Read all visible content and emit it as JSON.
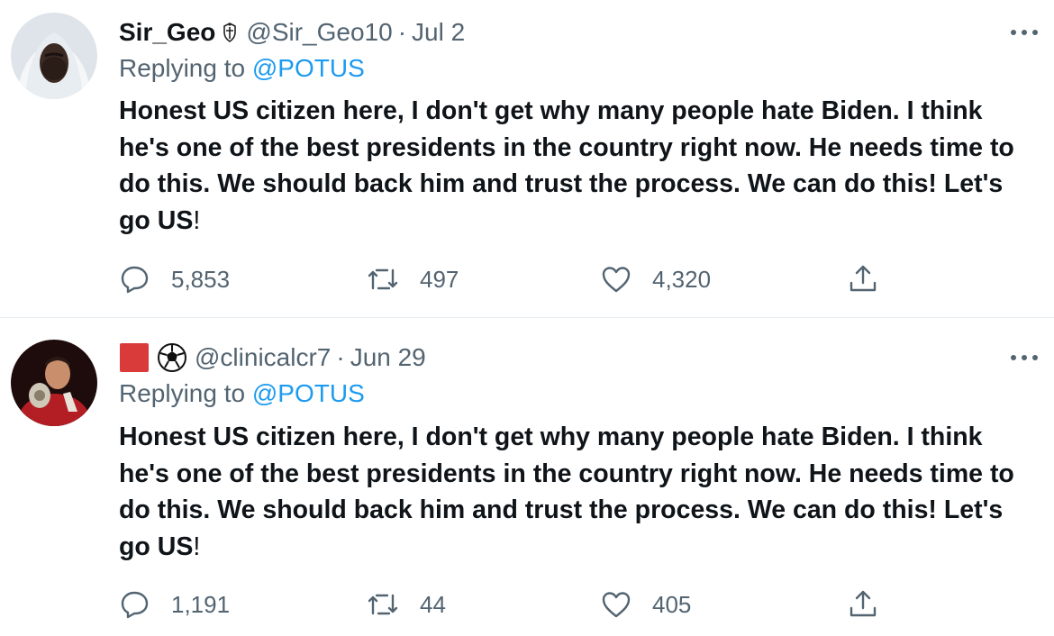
{
  "tweets": [
    {
      "display_name": "Sir_Geo",
      "handle": "@Sir_Geo10",
      "separator": "·",
      "date": "Jul 2",
      "reply_prefix": "Replying to ",
      "reply_to": "@POTUS",
      "text": "Honest US citizen here, I don't get why many people hate Biden. I think he's one of the best presidents  in the country right now. He needs time to do this. We should back him and trust the process. We can do this! Let's go US",
      "text_tail": "!",
      "replies": "5,853",
      "retweets": "497",
      "likes": "4,320"
    },
    {
      "display_name": "",
      "handle": "@clinicalcr7",
      "separator": "·",
      "date": "Jun 29",
      "reply_prefix": "Replying to ",
      "reply_to": "@POTUS",
      "text": "Honest US citizen here, I don't get why many people hate Biden. I think he's one of the best presidents  in the country right now. He needs time to do this. We should back him and trust the process. We can do this! Let's go US",
      "text_tail": "!",
      "replies": "1,191",
      "retweets": "44",
      "likes": "405"
    }
  ],
  "colors": {
    "text": "#0f1419",
    "secondary": "#536471",
    "link": "#1d9bf0",
    "divider": "#e6ecf0",
    "red_square": "#d93a3a"
  },
  "icons": {
    "badge_1": "crest-icon",
    "badge_2_a": "red-square-icon",
    "badge_2_b": "soccer-ball-icon",
    "reply": "reply-icon",
    "retweet": "retweet-icon",
    "like": "heart-icon",
    "share": "share-icon",
    "more": "more-icon"
  }
}
